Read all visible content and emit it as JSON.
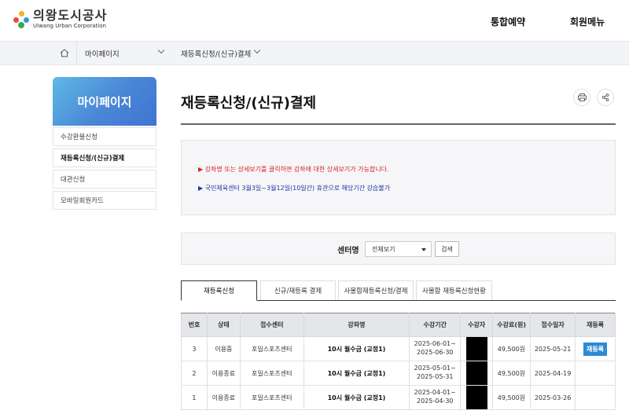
{
  "header": {
    "logo_ko": "의왕도시공사",
    "logo_en": "Uiwang Urban Corporation",
    "nav": [
      "통합예약",
      "회원메뉴"
    ]
  },
  "breadcrumb": {
    "items": [
      "마이페이지",
      "재등록신청/(신규)결제"
    ]
  },
  "sidebar": {
    "title": "마이페이지",
    "items": [
      {
        "label": "수강환불신청"
      },
      {
        "label": "재등록신청/(신규)결제"
      },
      {
        "label": "대관신청"
      },
      {
        "label": "모바일회원카드"
      }
    ]
  },
  "main": {
    "title": "재등록신청/(신규)결제",
    "notices": [
      "▶ 강좌명 또는 상세보기를 클릭하면 강좌에 대한 상세보기가 가능합니다.",
      "▶ 국민체육센터 3월3일~3월12일(10일간) 휴관으로 해당기간 강습불가"
    ],
    "search": {
      "label": "센터명",
      "selected": "전체보기",
      "button": "검색"
    },
    "tabs": [
      "재등록신청",
      "신규/재등록 결제",
      "사물함재등록신청/결제",
      "사물함 재등록신청현황"
    ],
    "table": {
      "headers": [
        "번호",
        "상태",
        "접수센터",
        "강좌명",
        "수강기간",
        "수강자",
        "수강료(원)",
        "접수일자",
        "재등록"
      ],
      "rows": [
        {
          "no": "3",
          "status": "이용중",
          "center": "포일스포츠센터",
          "course": "10시 월수금 (교정1)",
          "period_start": "2025-06-01~",
          "period_end": "2025-06-30",
          "fee": "49,500원",
          "date": "2025-05-21",
          "renew": "재등록"
        },
        {
          "no": "2",
          "status": "이용종료",
          "center": "포일스포츠센터",
          "course": "10시 월수금 (교정1)",
          "period_start": "2025-05-01~",
          "period_end": "2025-05-31",
          "fee": "49,500원",
          "date": "2025-04-19",
          "renew": ""
        },
        {
          "no": "1",
          "status": "이용종료",
          "center": "포일스포츠센터",
          "course": "10시 월수금 (교정1)",
          "period_start": "2025-04-01~",
          "period_end": "2025-04-30",
          "fee": "49,500원",
          "date": "2025-03-26",
          "renew": ""
        }
      ]
    }
  },
  "colors": {
    "accent_blue": "#2d8ad2",
    "notice_red": "#d8261b",
    "notice_blue": "#1d39a5"
  }
}
